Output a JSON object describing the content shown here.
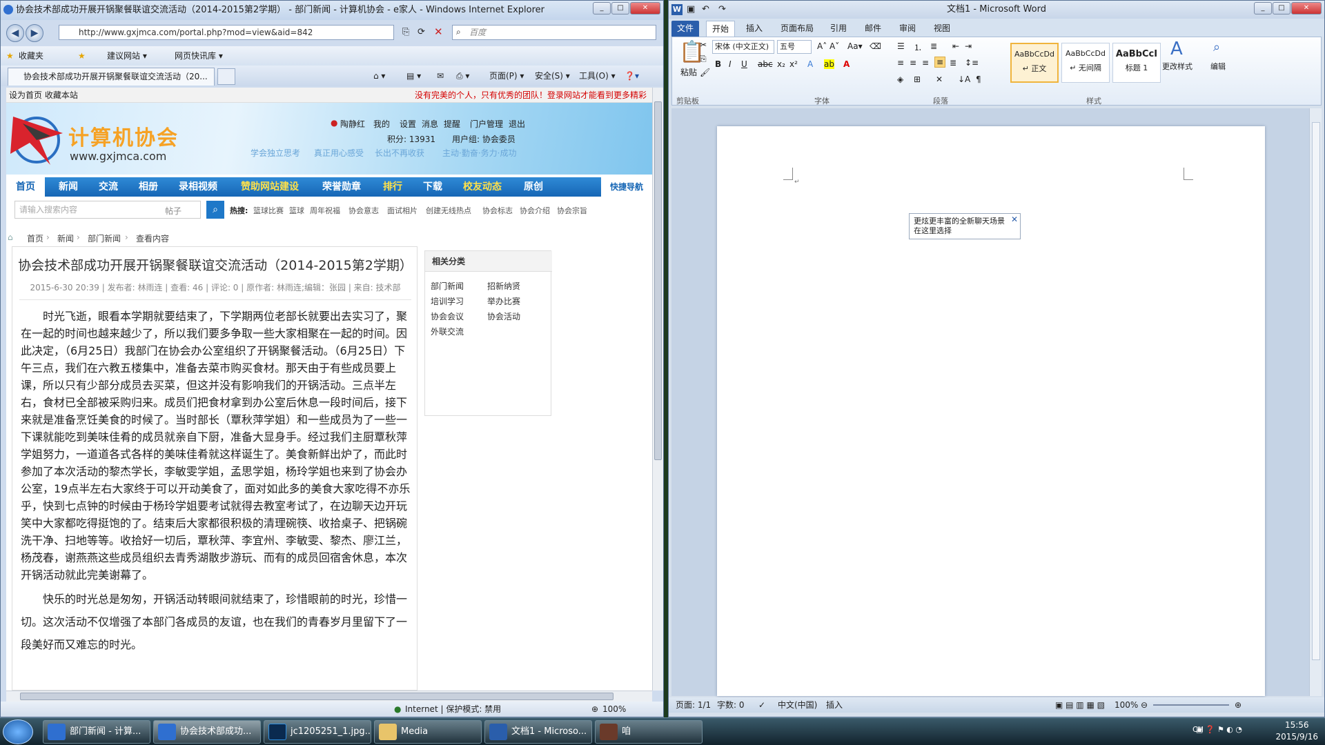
{
  "ie": {
    "title": "协会技术部成功开展开锅聚餐联谊交流活动（2014-2015第2学期） - 部门新闻 - 计算机协会 - e家人 - Windows Internet Explorer",
    "url": "http://www.gxjmca.com/portal.php?mod=view&aid=842",
    "search_placeholder": "百度",
    "fav_label": "收藏夹",
    "suggest_label": "建议网站 ▾",
    "webslice_label": "网页快讯库 ▾",
    "tab_title": "协会技术部成功开展开锅聚餐联谊交流活动（20...",
    "cmd": {
      "page": "页面(P) ▾",
      "safety": "安全(S) ▾",
      "tools": "工具(O) ▾"
    },
    "status_zone": "Internet | 保护模式: 禁用",
    "zoom": "100%"
  },
  "site": {
    "topbar_left": "设为首页  收藏本站",
    "topbar_notice": "没有完美的个人，只有优秀的团队！登录网站才能看到更多精彩",
    "logo_text": "计算机协会",
    "logo_url": "www.gxjmca.com",
    "user": {
      "name": "陶静红",
      "links": [
        "我的",
        "设置",
        "消息",
        "提醒",
        "门户管理",
        "退出"
      ],
      "points": "积分: 13931",
      "group": "用户组: 协会委员"
    },
    "slogans": [
      "学会独立思考",
      "真正用心感受",
      "长出不再收获",
      "主动·勤奋·务力·成功"
    ],
    "nav": [
      "首页",
      "新闻",
      "交流",
      "相册",
      "录相视频",
      "赞助网站建设",
      "荣誉勋章",
      "排行",
      "下载",
      "校友动态",
      "原创",
      "快捷导航"
    ],
    "search_placeholder": "请输入搜索内容",
    "search_type": "帖子",
    "hot_label": "热搜:",
    "hot": [
      "篮球比赛",
      "篮球",
      "周年祝福",
      "协会意志",
      "面试相片",
      "创建无线热点",
      "协会标志",
      "协会介绍",
      "协会宗旨"
    ],
    "breadcrumb": [
      "首页",
      "新闻",
      "部门新闻",
      "查看内容"
    ]
  },
  "article": {
    "title": "协会技术部成功开展开锅聚餐联谊交流活动（2014-2015第2学期）",
    "meta": "2015-6-30 20:39  |  发布者: 林雨连  |  查看: 46  |  评论: 0  |  原作者: 林雨连;编辑：张园  |  来自: 技术部",
    "p1": "时光飞逝，眼看本学期就要结束了，下学期两位老部长就要出去实习了，聚在一起的时间也越来越少了，所以我们要多争取一些大家相聚在一起的时间。因此决定，（6月25日）我部门在协会办公室组织了开锅聚餐活动。（6月25日）下午三点，我们在六教五楼集中，准备去菜市购买食材。那天由于有些成员要上课，所以只有少部分成员去买菜，但这并没有影响我们的开锅活动。三点半左右，食材已全部被采购归来。成员们把食材拿到办公室后休息一段时间后，接下来就是准备烹饪美食的时候了。当时部长（覃秋萍学姐）和一些成员为了一些一下课就能吃到美味佳肴的成员就亲自下厨，准备大显身手。经过我们主厨覃秋萍学姐努力，一道道各式各样的美味佳肴就这样诞生了。美食新鲜出炉了，而此时参加了本次活动的黎杰学长，李敏雯学姐，孟思学姐，杨玲学姐也来到了协会办公室，19点半左右大家终于可以开动美食了，面对如此多的美食大家吃得不亦乐乎，快到七点钟的时候由于杨玲学姐要考试就得去教室考试了，在边聊天边开玩笑中大家都吃得挺饱的了。结束后大家都很积极的清理碗筷、收拾桌子、把锅碗洗干净、扫地等等。收拾好一切后，覃秋萍、李宜州、李敏雯、黎杰、廖江兰，杨茂春，谢燕燕这些成员组织去青秀湖散步游玩、而有的成员回宿舍休息，本次开锅活动就此完美谢幕了。",
    "p2": "快乐的时光总是匆匆，开锅活动转眼间就结束了，珍惜眼前的时光，珍惜一切。这次活动不仅增强了本部门各成员的友谊，也在我们的青春岁月里留下了一段美好而又难忘的时光。"
  },
  "sidebar": {
    "heading": "相关分类",
    "items": [
      "部门新闻",
      "招新纳贤",
      "培训学习",
      "举办比赛",
      "协会会议",
      "协会活动",
      "外联交流"
    ]
  },
  "word": {
    "title": "文档1 - Microsoft Word",
    "tabs": [
      "文件",
      "开始",
      "插入",
      "页面布局",
      "引用",
      "邮件",
      "审阅",
      "视图"
    ],
    "font_name": "宋体 (中文正文)",
    "font_size": "五号",
    "paste_label": "粘贴",
    "groups": [
      "剪贴板",
      "字体",
      "段落",
      "样式"
    ],
    "styles": [
      {
        "sample": "AaBbCcDd",
        "name": "↵ 正文"
      },
      {
        "sample": "AaBbCcDd",
        "name": "↵ 无间隔"
      },
      {
        "sample": "AaBbCcI",
        "name": "标题 1"
      }
    ],
    "change_styles": "更改样式",
    "edit_label": "编辑",
    "tooltip": "更炫更丰富的全新聊天场景在这里选择",
    "status": {
      "page": "页面: 1/1",
      "words": "字数: 0",
      "lang": "中文(中国)",
      "mode": "插入",
      "zoom": "100%"
    }
  },
  "taskbar": {
    "items": [
      "部门新闻 - 计算...",
      "协会技术部成功...",
      "jc1205251_1.jpg...",
      "Media",
      "文档1 - Microso...",
      "咱"
    ],
    "lang": "CH",
    "time": "15:56",
    "date": "2015/9/16"
  }
}
